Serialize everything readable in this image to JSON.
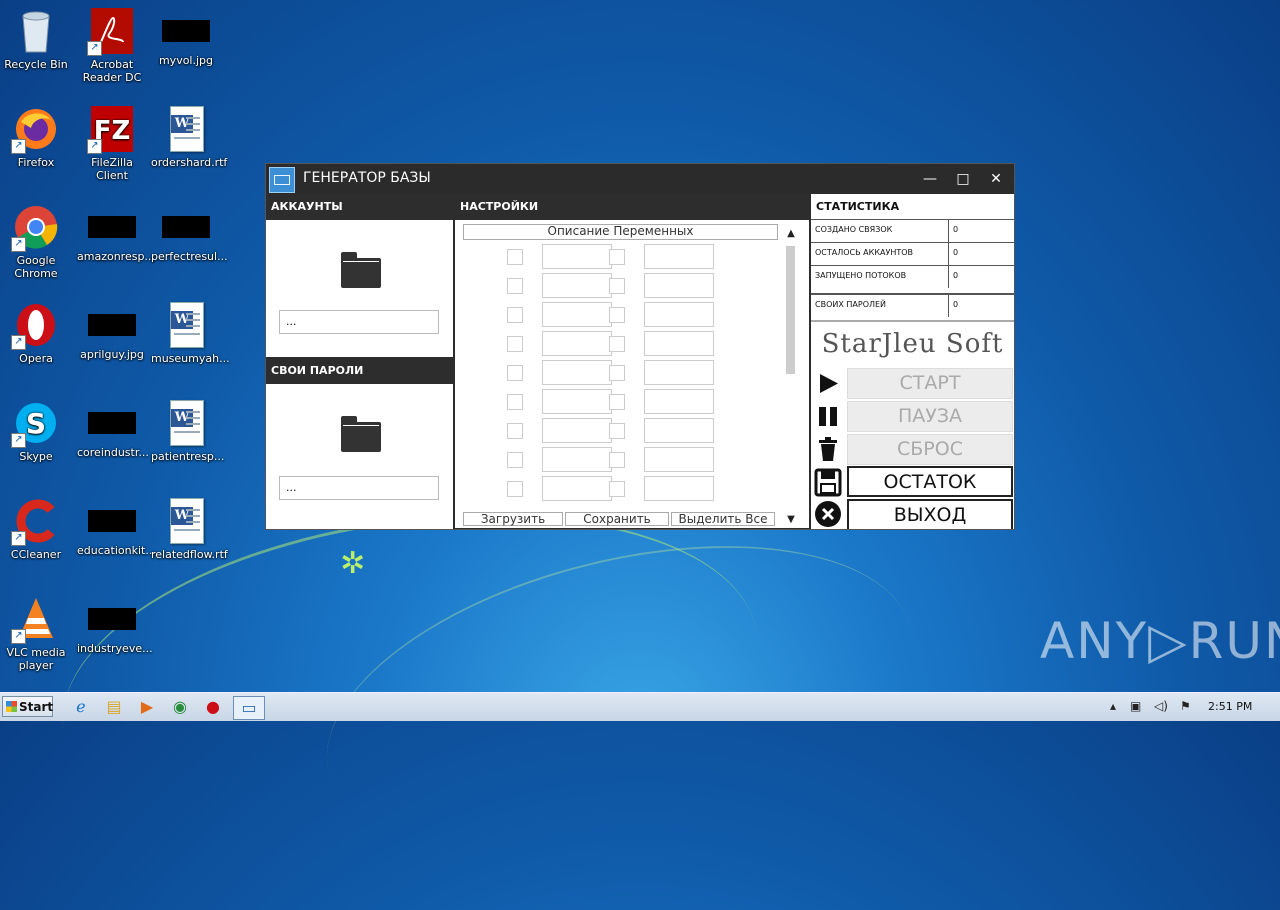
{
  "desktop": {
    "icons": [
      {
        "label": "Recycle Bin",
        "icon": "recycle-bin-icon"
      },
      {
        "label": "Acrobat Reader DC",
        "icon": "acrobat-icon"
      },
      {
        "label": "myvol.jpg",
        "icon": "image-file-icon"
      },
      {
        "label": "Firefox",
        "icon": "firefox-icon"
      },
      {
        "label": "FileZilla Client",
        "icon": "filezilla-icon"
      },
      {
        "label": "ordershard.rtf",
        "icon": "word-doc-icon"
      },
      {
        "label": "Google Chrome",
        "icon": "chrome-icon"
      },
      {
        "label": "amazonresp...",
        "icon": "image-file-icon"
      },
      {
        "label": "perfectresul...",
        "icon": "image-file-icon"
      },
      {
        "label": "Opera",
        "icon": "opera-icon"
      },
      {
        "label": "aprilguy.jpg",
        "icon": "image-file-icon"
      },
      {
        "label": "museumyah...",
        "icon": "word-doc-icon"
      },
      {
        "label": "Skype",
        "icon": "skype-icon"
      },
      {
        "label": "coreindustr...",
        "icon": "image-file-icon"
      },
      {
        "label": "patientresp...",
        "icon": "word-doc-icon"
      },
      {
        "label": "CCleaner",
        "icon": "ccleaner-icon"
      },
      {
        "label": "educationkit...",
        "icon": "image-file-icon"
      },
      {
        "label": "relatedflow.rtf",
        "icon": "word-doc-icon"
      },
      {
        "label": "VLC media player",
        "icon": "vlc-icon"
      },
      {
        "label": "industryeve...",
        "icon": "image-file-icon"
      }
    ],
    "watermark": "ANY▷RUN"
  },
  "window": {
    "title": "ГЕНЕРАТОР БАЗЫ",
    "minimize": "—",
    "maximize": "□",
    "close": "✕",
    "accounts": {
      "header": "АККАУНТЫ",
      "path": "..."
    },
    "passwords": {
      "header": "СВОИ ПАРОЛИ",
      "path": "..."
    },
    "settings": {
      "header": "НАСТРОЙКИ",
      "desc_button": "Описание Переменных",
      "load": "Загрузить",
      "save": "Сохранить",
      "select_all": "Выделить Все"
    },
    "stats": {
      "header": "СТАТИСТИКА",
      "rows": [
        {
          "label": "СОЗДАНО СВЯЗОК",
          "value": "0"
        },
        {
          "label": "ОСТАЛОСЬ АККАУНТОВ",
          "value": "0"
        },
        {
          "label": "ЗАПУЩЕНО ПОТОКОВ",
          "value": "0"
        },
        {
          "label": "СВОИХ ПАРОЛЕЙ",
          "value": "0"
        }
      ],
      "brand": "StarJleu Soft"
    },
    "controls": {
      "start": "СТАРТ",
      "pause": "ПАУЗА",
      "reset": "СБРОС",
      "remainder": "ОСТАТОК",
      "exit": "ВЫХОД"
    }
  },
  "taskbar": {
    "start": "Start",
    "clock": "2:51 PM"
  }
}
